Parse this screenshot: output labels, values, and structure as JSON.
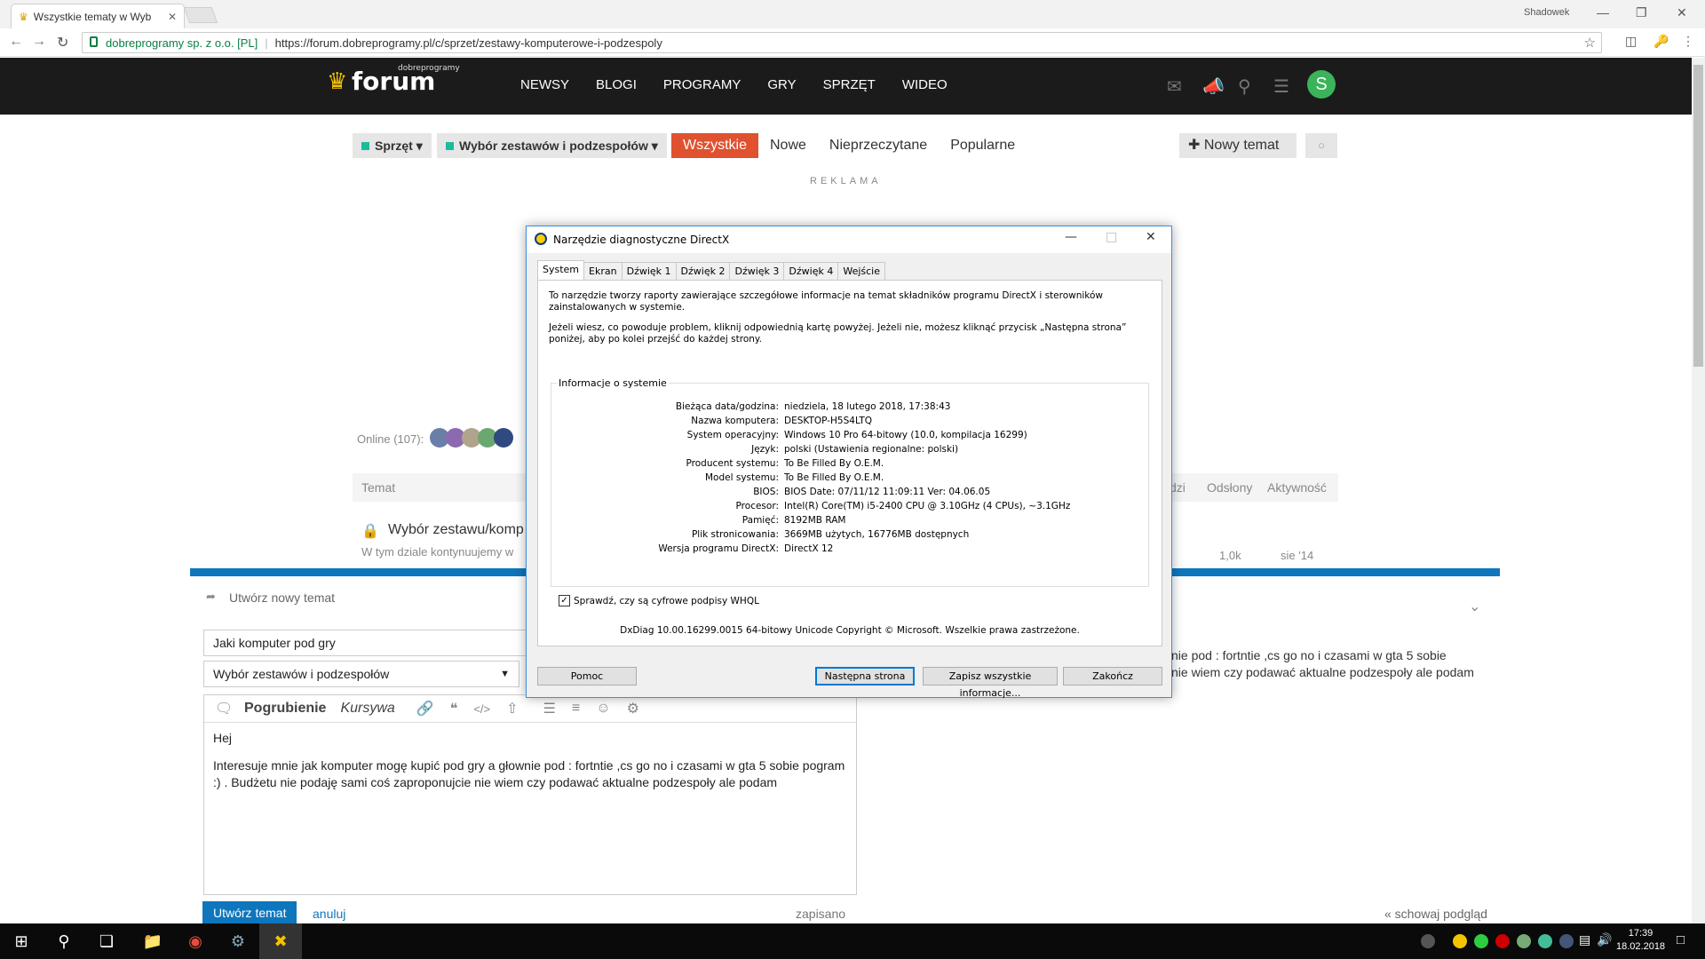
{
  "browser": {
    "tab_title": "Wszystkie tematy w Wyb",
    "profile": "Shadowek",
    "security_label": "dobreprogramy sp. z o.o. [PL]",
    "url": "https://forum.dobreprogramy.pl/c/sprzet/zestawy-komputerowe-i-podzespoly"
  },
  "site": {
    "logo_small": "dobreprogramy",
    "logo": "forum",
    "nav": [
      "NEWSY",
      "BLOGI",
      "PROGRAMY",
      "GRY",
      "SPRZĘT",
      "WIDEO"
    ],
    "avatar_letter": "S"
  },
  "toolbar": {
    "category": "Sprzęt",
    "subcategory": "Wybór zestawów i podzespołów",
    "tabs": [
      "Wszystkie",
      "Nowe",
      "Nieprzeczytane",
      "Popularne"
    ],
    "new_topic": "Nowy temat"
  },
  "ad_label": "REKLAMA",
  "online": "Online (107):",
  "table": {
    "col_topic": "Temat",
    "col_posts": "dzi",
    "col_views": "Odsłony",
    "col_activity": "Aktywność",
    "row1_title": "Wybór zestawu/komp",
    "row1_excerpt": "W tym dziale kontynuujemy w",
    "row1_views": "1,0k",
    "row1_activity": "sie '14"
  },
  "composer": {
    "title": "Utwórz nowy temat",
    "topic_value": "Jaki komputer pod gry",
    "category_value": "Wybór zestawów i podzespołów",
    "bold": "Pogrubienie",
    "italic": "Kursywa",
    "body_line1": "Hej",
    "body_line2": "Interesuje mnie jak komputer mogę kupić pod gry a głownie pod : fortntie ,cs go no i czasami w gta 5 sobie pogram :) . Budżetu nie podaję sami coś zaproponujcie nie wiem czy podawać aktualne podzespoły ale podam",
    "preview_line1": "nie pod : fortntie ,cs go no i czasami w gta 5 sobie",
    "preview_line2": "nie wiem czy podawać aktualne podzespoły ale podam",
    "submit": "Utwórz temat",
    "cancel": "anuluj",
    "saved": "zapisano",
    "hide_preview": "« schowaj podgląd"
  },
  "dialog": {
    "title": "Narzędzie diagnostyczne DirectX",
    "tabs": [
      "System",
      "Ekran",
      "Dźwięk 1",
      "Dźwięk 2",
      "Dźwięk 3",
      "Dźwięk 4",
      "Wejście"
    ],
    "intro1": "To narzędzie tworzy raporty zawierające szczegółowe informacje na temat składników programu DirectX i sterowników zainstalowanych w systemie.",
    "intro2": "Jeżeli wiesz, co powoduje problem, kliknij odpowiednią kartę powyżej. Jeżeli nie, możesz kliknąć przycisk „Następna strona” poniżej, aby po kolei przejść do każdej strony.",
    "group_title": "Informacje o systemie",
    "info": [
      {
        "k": "Bieżąca data/godzina:",
        "v": "niedziela, 18 lutego 2018, 17:38:43"
      },
      {
        "k": "Nazwa komputera:",
        "v": "DESKTOP-H5S4LTQ"
      },
      {
        "k": "System operacyjny:",
        "v": "Windows 10 Pro 64-bitowy (10.0, kompilacja 16299)"
      },
      {
        "k": "Język:",
        "v": "polski (Ustawienia regionalne: polski)"
      },
      {
        "k": "Producent systemu:",
        "v": "To Be Filled By O.E.M."
      },
      {
        "k": "Model systemu:",
        "v": "To Be Filled By O.E.M."
      },
      {
        "k": "BIOS:",
        "v": "BIOS Date: 07/11/12 11:09:11 Ver: 04.06.05"
      },
      {
        "k": "Procesor:",
        "v": "Intel(R) Core(TM) i5-2400 CPU @ 3.10GHz (4 CPUs), ~3.1GHz"
      },
      {
        "k": "Pamięć:",
        "v": "8192MB RAM"
      },
      {
        "k": "Plik stronicowania:",
        "v": "3669MB użytych, 16776MB dostępnych"
      },
      {
        "k": "Wersja programu DirectX:",
        "v": "DirectX 12"
      }
    ],
    "whql": "Sprawdź, czy są cyfrowe podpisy WHQL",
    "version_line": "DxDiag 10.00.16299.0015 64-bitowy Unicode  Copyright © Microsoft. Wszelkie prawa zastrzeżone.",
    "btn_help": "Pomoc",
    "btn_next": "Następna strona",
    "btn_save": "Zapisz wszystkie informacje...",
    "btn_exit": "Zakończ"
  },
  "taskbar": {
    "time": "17:39",
    "date": "18.02.2018"
  }
}
